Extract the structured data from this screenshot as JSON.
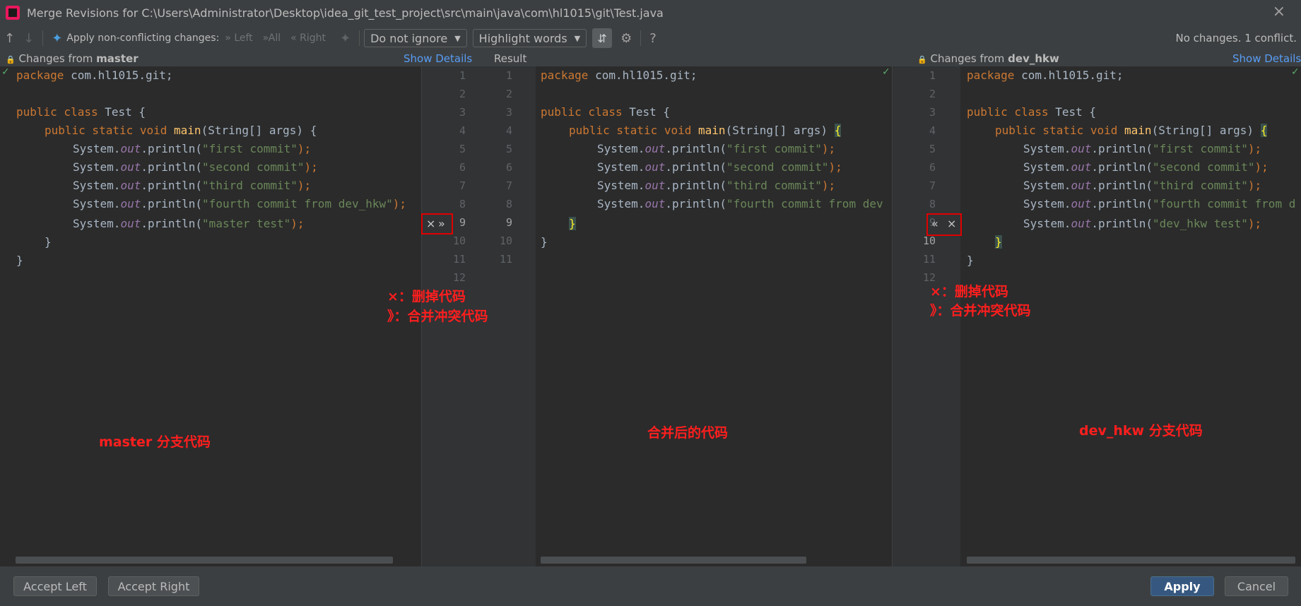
{
  "window": {
    "title": "Merge Revisions for C:\\Users\\Administrator\\Desktop\\idea_git_test_project\\src\\main\\java\\com\\hl1015\\git\\Test.java",
    "close_icon": "×"
  },
  "toolbar": {
    "apply_label": "Apply non-conflicting changes:",
    "left": "Left",
    "all": "All",
    "right": "Right",
    "ignore_combo": "Do not ignore",
    "highlight_combo": "Highlight words",
    "help": "?",
    "status": "No changes. 1 conflict."
  },
  "panels": {
    "left": {
      "prefix": "Changes from ",
      "branch": "master",
      "show_details": "Show Details"
    },
    "center": {
      "title": "Result"
    },
    "right": {
      "prefix": "Changes from ",
      "branch": "dev_hkw",
      "show_details": "Show Details"
    }
  },
  "code": {
    "package_kw": "package",
    "package_name": " com.hl1015.git;",
    "public_kw": "public",
    "class_kw": " class",
    "class_name": " Test {",
    "static_void": " static void",
    "main_fn": " main",
    "main_args": "(String[] args) ",
    "open_brace": "{",
    "close_brace": "}",
    "system": "System.",
    "out": "out",
    "println": ".println(",
    "semi": ");",
    "s1": "\"first commit\"",
    "s2": "\"second commit\"",
    "s3": "\"third commit\"",
    "s4": "\"fourth commit from dev_hkw\"",
    "s4_center": "\"fourth commit from dev",
    "s4_right": "\"fourth commit from d",
    "s_master": "\"master test\"",
    "s_dev": "\"dev_hkw test\""
  },
  "gutter": {
    "left_nums": [
      "1",
      "2",
      "3",
      "4",
      "5",
      "6",
      "7",
      "8",
      "9",
      "10",
      "11",
      "12"
    ],
    "result_left_nums": [
      "1",
      "2",
      "3",
      "4",
      "5",
      "6",
      "7",
      "8",
      "9",
      "10",
      "11"
    ],
    "right_nums": [
      "1",
      "2",
      "3",
      "4",
      "5",
      "6",
      "7",
      "8",
      "9",
      "10",
      "11",
      "12"
    ]
  },
  "annotations": {
    "delete_note": "×：删掉代码",
    "merge_note": "》：合并冲突代码",
    "delete_note_r": "×：删掉代码",
    "merge_note_r": "》：合并冲突代码",
    "master_label": "master 分支代码",
    "result_label": "合并后的代码",
    "dev_label": "dev_hkw 分支代码"
  },
  "buttons": {
    "accept_left": "Accept Left",
    "accept_right": "Accept Right",
    "apply": "Apply",
    "cancel": "Cancel"
  },
  "icons": {
    "up_arrow": "↑",
    "down_arrow": "↓",
    "magic": "✦",
    "double_right": "»",
    "double_left": "«",
    "x": "×",
    "settings": "⚙",
    "lock": "🔒",
    "check": "✓"
  },
  "colors": {
    "background": "#2b2b2b",
    "gutter": "#313335",
    "toolbar": "#3c3f41",
    "conflict": "#4a3b35",
    "annotation": "#ff1e1e",
    "link": "#589df6"
  }
}
